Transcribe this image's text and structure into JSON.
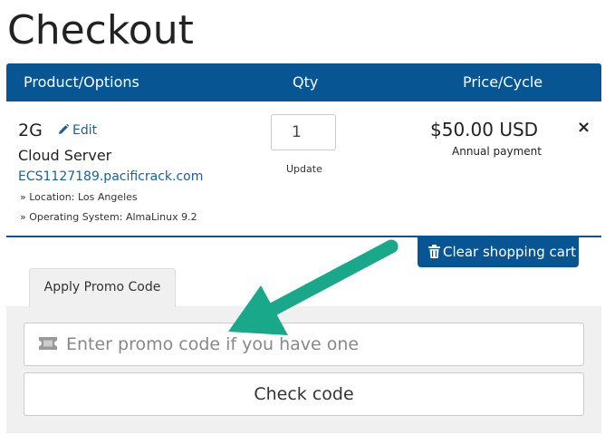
{
  "page": {
    "title": "Checkout"
  },
  "cart": {
    "headers": {
      "product": "Product/Options",
      "qty": "Qty",
      "price": "Price/Cycle"
    },
    "item": {
      "name": "2G",
      "edit_label": "Edit",
      "group": "Cloud Server",
      "domain": "ECS1127189.pacificrack.com",
      "options": [
        "» Location: Los Angeles",
        "» Operating System: AlmaLinux 9.2"
      ],
      "qty": "1",
      "update_label": "Update",
      "price": "$50.00 USD",
      "cycle": "Annual payment",
      "remove_icon": "×"
    },
    "clear_label": "Clear shopping cart"
  },
  "promo": {
    "tab_label": "Apply Promo Code",
    "placeholder": "Enter promo code if you have one",
    "check_label": "Check code"
  },
  "colors": {
    "header_bg": "#075592",
    "link": "#1a5f9c",
    "arrow": "#1aa88a",
    "panel_bg": "#f0f0f0"
  },
  "icons": [
    "pencil-icon",
    "trash-icon",
    "ticket-icon",
    "close-icon",
    "pointer-arrow"
  ]
}
